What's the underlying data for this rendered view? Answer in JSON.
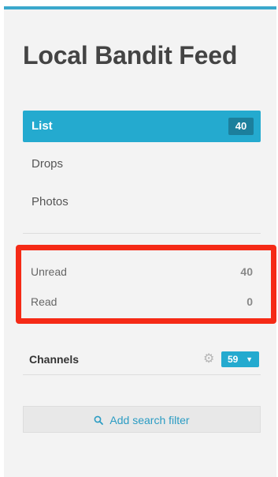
{
  "app": {
    "title": "Local Bandit Feed"
  },
  "nav": {
    "items": [
      {
        "label": "List",
        "count": "40",
        "active": true
      },
      {
        "label": "Drops"
      },
      {
        "label": "Photos"
      }
    ]
  },
  "filters": {
    "items": [
      {
        "label": "Unread",
        "count": "40"
      },
      {
        "label": "Read",
        "count": "0"
      }
    ]
  },
  "channels": {
    "label": "Channels",
    "count": "59",
    "settings_icon": "gear-icon",
    "dropdown_icon": "caret-down-icon"
  },
  "search_filter": {
    "label": "Add search filter",
    "icon": "search-icon"
  },
  "colors": {
    "accent": "#24aacf",
    "highlight": "#f52a16"
  }
}
